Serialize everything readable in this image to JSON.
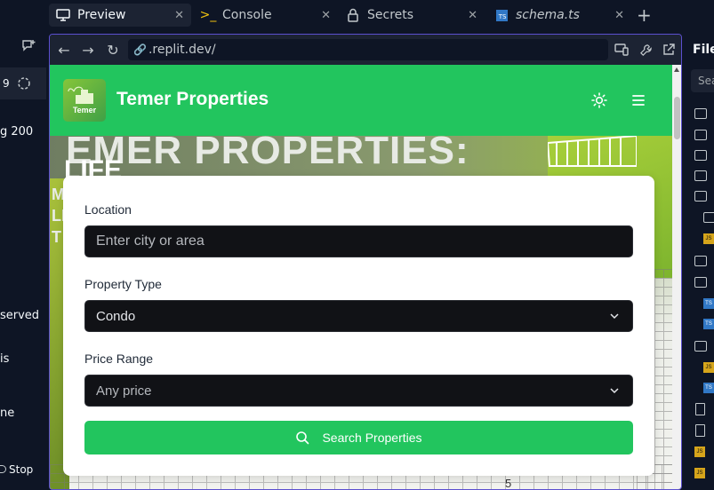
{
  "tabs": [
    {
      "label": "Preview",
      "icon": "monitor-icon",
      "active": true
    },
    {
      "label": "Console",
      "icon": "terminal-icon",
      "active": false
    },
    {
      "label": "Secrets",
      "icon": "lock-icon",
      "active": false
    },
    {
      "label": "schema.ts",
      "icon": "typescript-file-icon",
      "active": false
    }
  ],
  "left_pane": {
    "line_1": "9",
    "line_2": "g 200",
    "line_3": "served",
    "line_4": "is",
    "line_5": "ne",
    "stop_label": "Stop"
  },
  "browser": {
    "url": ".replit.dev/"
  },
  "app": {
    "brand": "Temer Properties",
    "logo_text": "Temer",
    "accent_color": "#22c55e"
  },
  "hero": {
    "title_text": "EMER PROPERTIES:",
    "subtitle_text": "LIFE",
    "side_letters": [
      "M",
      "LE",
      "T"
    ],
    "number_text": "5"
  },
  "search_form": {
    "location_label": "Location",
    "location_placeholder": "Enter city or area",
    "type_label": "Property Type",
    "type_value": "Condo",
    "price_label": "Price Range",
    "price_value": "Any price",
    "button_label": "Search Properties"
  },
  "right_pane": {
    "title": "File",
    "search_placeholder": "Sea"
  }
}
